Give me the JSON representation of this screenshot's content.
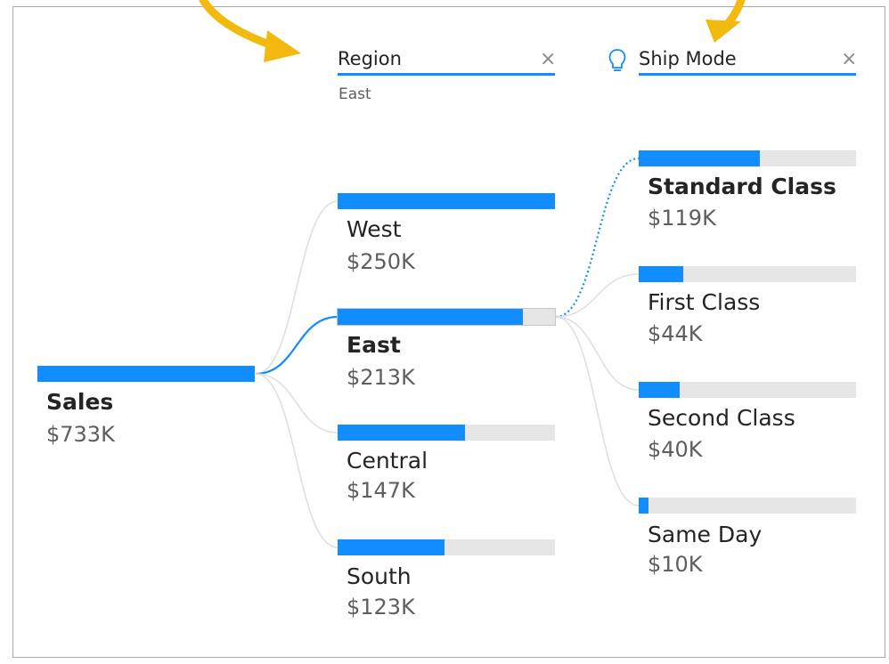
{
  "colors": {
    "bar": "#118dff",
    "track": "#e6e6e6",
    "connector": "#e1dfdd",
    "active_connector": "#118dff",
    "arrow": "#f2b90f"
  },
  "icons": {
    "clear": "×",
    "insight": "lightbulb-icon"
  },
  "root": {
    "label": "Sales",
    "value_label": "$733K",
    "value": 733
  },
  "levels": [
    {
      "title": "Region",
      "filter": "East",
      "nodes": [
        {
          "label": "West",
          "value_label": "$250K",
          "value": 250,
          "selected": false
        },
        {
          "label": "East",
          "value_label": "$213K",
          "value": 213,
          "selected": true
        },
        {
          "label": "Central",
          "value_label": "$147K",
          "value": 147,
          "selected": false
        },
        {
          "label": "South",
          "value_label": "$123K",
          "value": 123,
          "selected": false
        }
      ]
    },
    {
      "title": "Ship Mode",
      "nodes": [
        {
          "label": "Standard Class",
          "value_label": "$119K",
          "value": 119,
          "selected": true
        },
        {
          "label": "First Class",
          "value_label": "$44K",
          "value": 44,
          "selected": false
        },
        {
          "label": "Second Class",
          "value_label": "$40K",
          "value": 40,
          "selected": false
        },
        {
          "label": "Same Day",
          "value_label": "$10K",
          "value": 10,
          "selected": false
        }
      ]
    }
  ],
  "chart_data": {
    "type": "bar",
    "title": "",
    "root": {
      "category": "Sales",
      "value": 733
    },
    "series": [
      {
        "categories": [
          "West",
          "East",
          "Central",
          "South"
        ],
        "values": [
          250,
          213,
          147,
          123
        ]
      },
      {
        "categories": [
          "Standard Class",
          "First Class",
          "Second Class",
          "Same Day"
        ],
        "values": [
          119,
          44,
          40,
          10
        ]
      }
    ],
    "value_unit": "K"
  }
}
